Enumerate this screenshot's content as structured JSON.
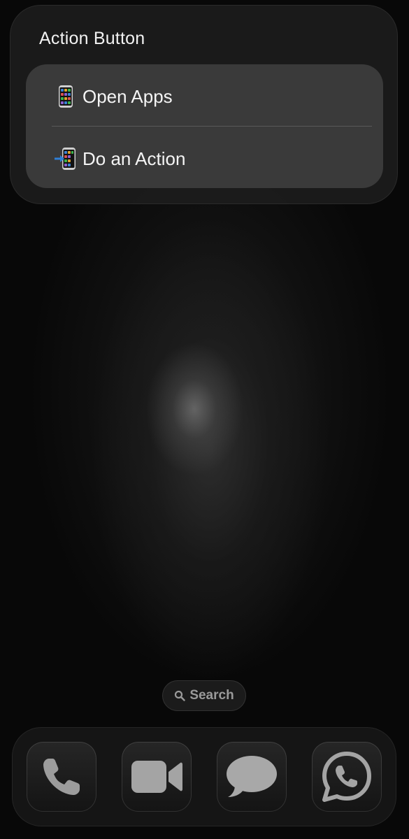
{
  "widget": {
    "title": "Action Button",
    "items": [
      {
        "icon": "mobile-phone-icon",
        "label": "Open Apps"
      },
      {
        "icon": "mobile-phone-with-arrow-icon",
        "label": "Do an Action"
      }
    ]
  },
  "search": {
    "label": "Search",
    "icon": "magnifying-glass-icon"
  },
  "dock": {
    "apps": [
      {
        "name": "Phone",
        "icon": "phone-handset-icon"
      },
      {
        "name": "FaceTime",
        "icon": "video-camera-icon"
      },
      {
        "name": "Messages",
        "icon": "speech-bubble-icon"
      },
      {
        "name": "WhatsApp",
        "icon": "whatsapp-icon"
      }
    ]
  },
  "colors": {
    "background": "#080808",
    "widget_background": "#1c1c1c",
    "menu_background": "#3a3a3a",
    "text": "#f4f4f4",
    "search_text": "#9a9a9a",
    "icon_gray": "#a0a0a0",
    "phone_blue": "#2f7fd6"
  }
}
